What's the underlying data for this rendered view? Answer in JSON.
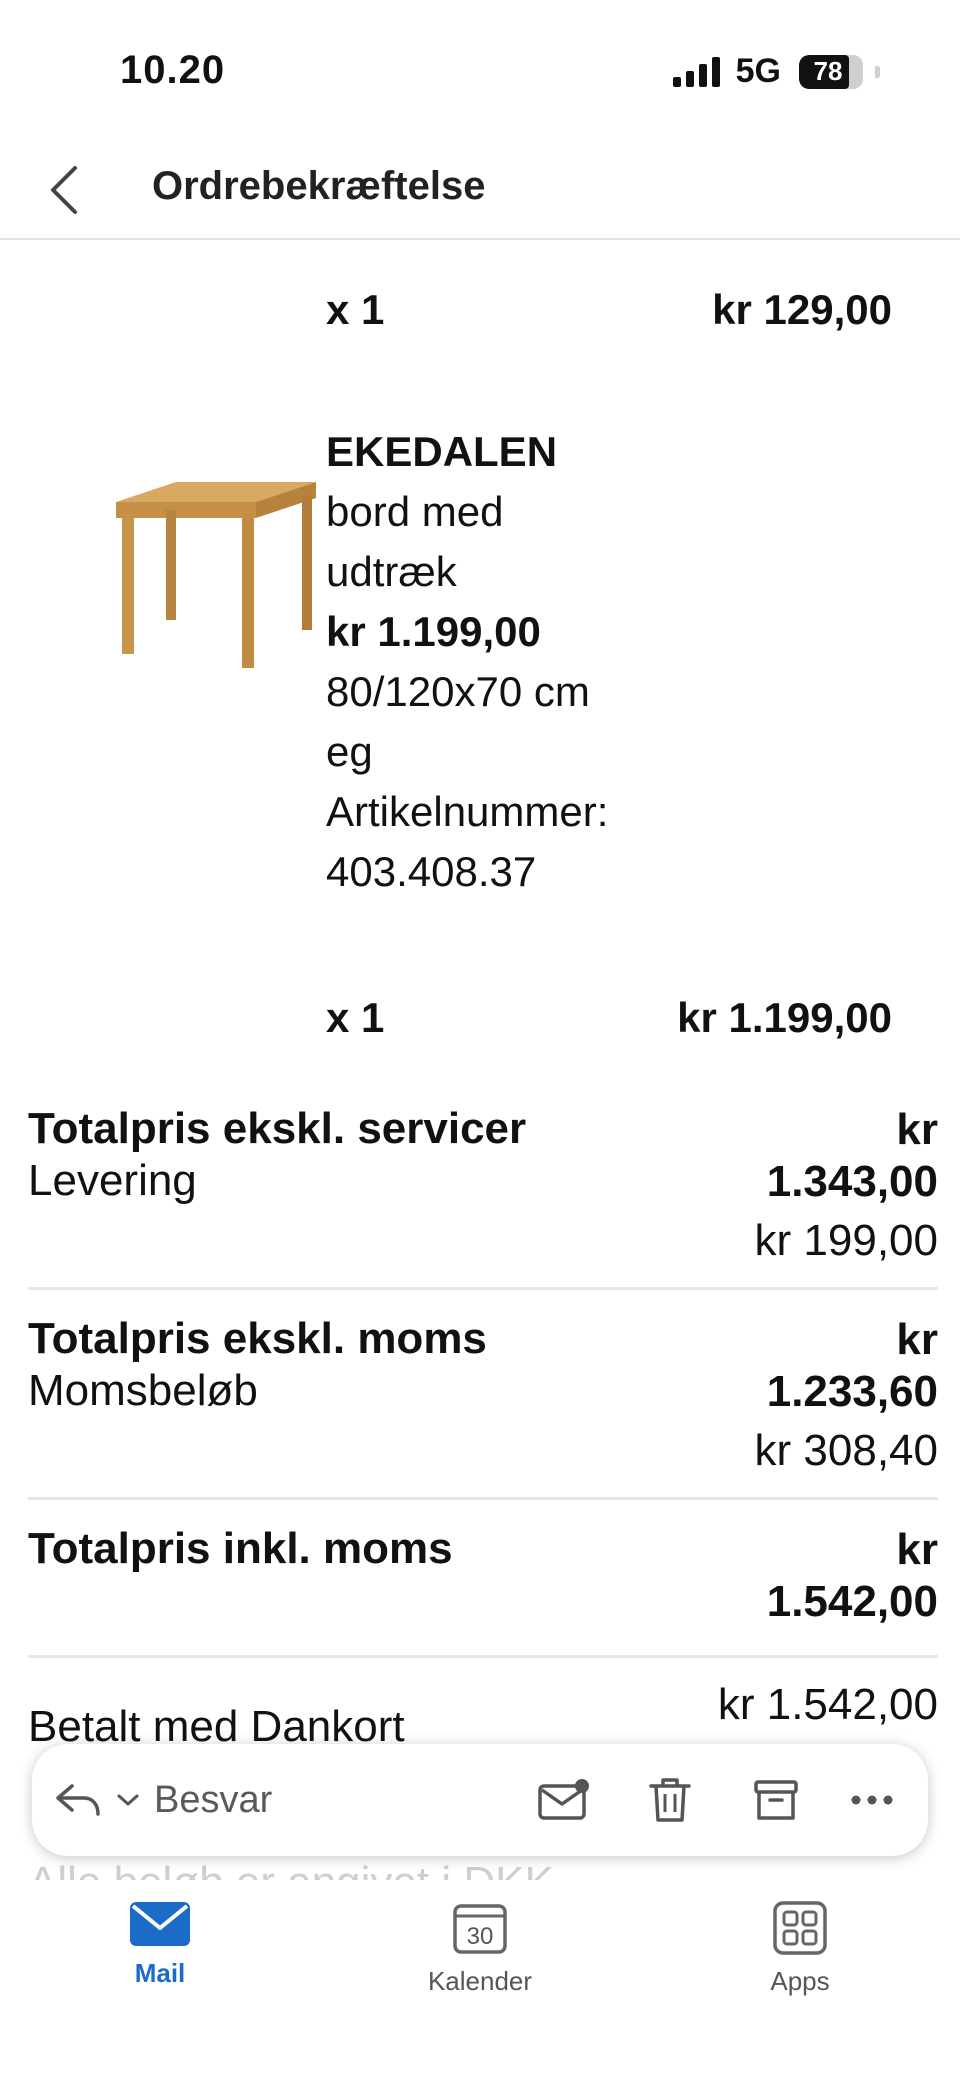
{
  "status": {
    "time": "10.20",
    "network": "5G",
    "battery": "78",
    "battery_level": 0.78
  },
  "header": {
    "title": "Ordrebekræftelse"
  },
  "items": [
    {
      "qty": "x 1",
      "line_total": "kr 129,00"
    },
    {
      "qty": "x 1",
      "line_total": "kr 1.199,00"
    }
  ],
  "product": {
    "name": "EKEDALEN",
    "desc_line1": "bord med",
    "desc_line2": "udtræk",
    "price": "kr 1.199,00",
    "size": "80/120x70 cm",
    "material": "eg",
    "article_label": "Artikelnummer:",
    "article_number": "403.408.37"
  },
  "summary": {
    "excl_services_label": "Totalpris ekskl. servicer",
    "excl_services_currency": "kr",
    "excl_services_value": "1.343,00",
    "delivery_label": "Levering",
    "delivery_value": "kr 199,00",
    "excl_vat_label": "Totalpris ekskl. moms",
    "excl_vat_currency": "kr",
    "excl_vat_value": "1.233,60",
    "vat_label": "Momsbeløb",
    "vat_value": "kr 308,40",
    "incl_vat_label": "Totalpris inkl. moms",
    "incl_vat_currency": "kr",
    "incl_vat_value": "1.542,00",
    "paid_label": "Betalt med Dankort",
    "paid_value": "kr 1.542,00",
    "footnote": "Alle beløb er angivet i DKK"
  },
  "action_bar": {
    "reply_label": "Besvar"
  },
  "tabs": [
    {
      "label": "Mail",
      "active": true
    },
    {
      "label": "Kalender",
      "active": false,
      "day": "30"
    },
    {
      "label": "Apps",
      "active": false
    }
  ],
  "colors": {
    "accent": "#1a6cc8",
    "divider": "#e6e6e6",
    "wood": "#c9954c"
  }
}
